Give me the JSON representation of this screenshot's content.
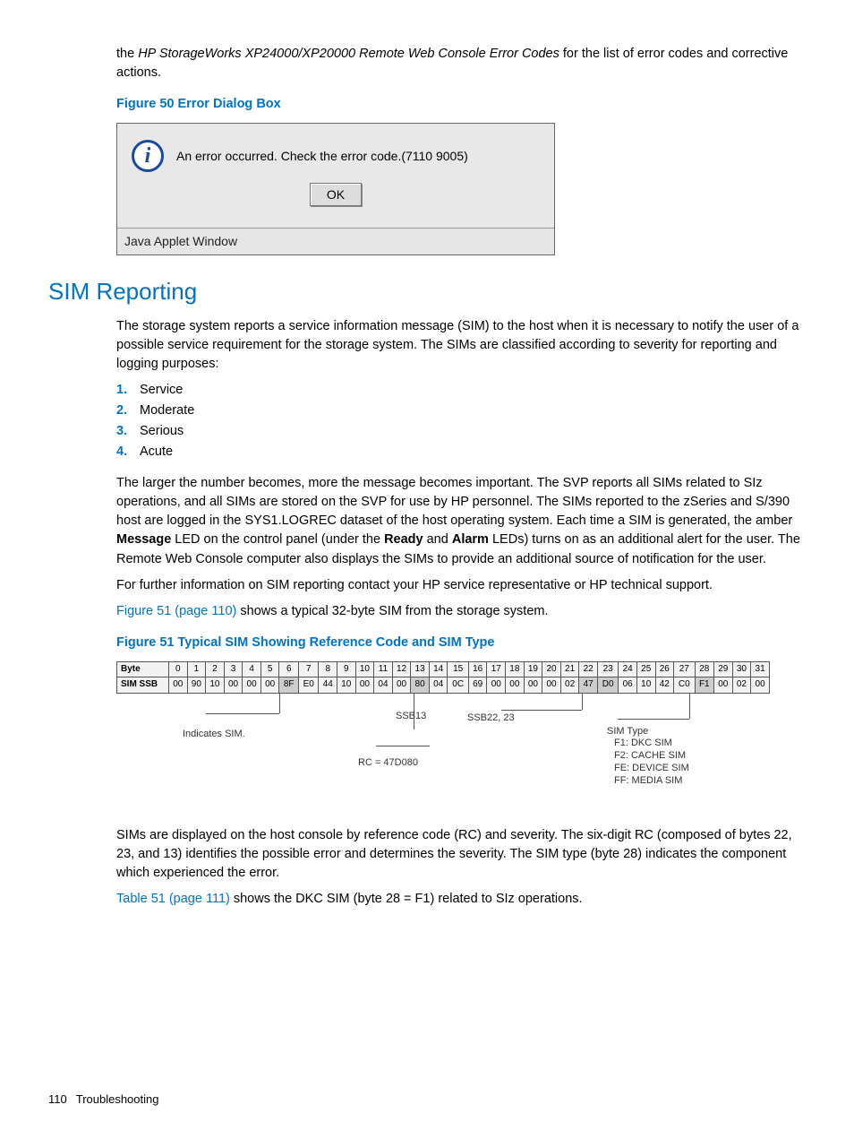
{
  "intro": {
    "prefix": "the ",
    "italic": "HP StorageWorks XP24000/XP20000 Remote Web Console Error Codes",
    "suffix": " for the list of error codes and corrective actions."
  },
  "figure50": {
    "caption": "Figure 50 Error Dialog Box",
    "message": "An error occurred. Check the error code.(7110 9005)",
    "ok": "OK",
    "status": "Java Applet Window"
  },
  "section": {
    "heading": "SIM Reporting",
    "p1": "The storage system reports a service information message (SIM) to the host when it is necessary to notify the user of a possible service requirement for the storage system. The SIMs are classified according to severity for reporting and logging purposes:",
    "list": {
      "n1": "1.",
      "i1": "Service",
      "n2": "2.",
      "i2": "Moderate",
      "n3": "3.",
      "i3": "Serious",
      "n4": "4.",
      "i4": "Acute"
    },
    "p2_a": "The larger the number becomes, more the message becomes important. The SVP reports all SIMs related to SIz operations, and all SIMs are stored on the SVP for use by HP personnel. The SIMs reported to the zSeries and S/390 host are logged in the SYS1.LOGREC dataset of the host operating system. Each time a SIM is generated, the amber ",
    "p2_b_bold": "Message",
    "p2_c": " LED on the control panel (under the ",
    "p2_d_bold": "Ready",
    "p2_e": " and ",
    "p2_f_bold": "Alarm",
    "p2_g": " LEDs) turns on as an additional alert for the user. The Remote Web Console computer also displays the SIMs to provide an additional source of notification for the user.",
    "p3": "For further information on SIM reporting contact your HP service representative or HP technical support.",
    "p4_link": "Figure 51 (page 110)",
    "p4_rest": " shows a typical 32-byte SIM from the storage system."
  },
  "figure51": {
    "caption": "Figure 51 Typical SIM Showing Reference Code and SIM Type",
    "row1_label": "Byte",
    "row2_label": "SIM SSB",
    "bytes_header": [
      "0",
      "1",
      "2",
      "3",
      "4",
      "5",
      "6",
      "7",
      "8",
      "9",
      "10",
      "11",
      "12",
      "13",
      "14",
      "15",
      "16",
      "17",
      "18",
      "19",
      "20",
      "21",
      "22",
      "23",
      "24",
      "25",
      "26",
      "27",
      "28",
      "29",
      "30",
      "31"
    ],
    "bytes_values": [
      "00",
      "90",
      "10",
      "00",
      "00",
      "00",
      "8F",
      "E0",
      "44",
      "10",
      "00",
      "04",
      "00",
      "80",
      "04",
      "0C",
      "69",
      "00",
      "00",
      "00",
      "00",
      "02",
      "47",
      "D0",
      "06",
      "10",
      "42",
      "C0",
      "F1",
      "00",
      "02",
      "00"
    ],
    "anno": {
      "indicates": "Indicates SIM.",
      "ssb13": "SSB13",
      "ssb2223": "SSB22, 23",
      "rc": "RC = 47D080",
      "simtype_title": "SIM Type",
      "simtype_lines": "F1: DKC SIM\nF2: CACHE SIM\nFE: DEVICE SIM\nFF: MEDIA SIM"
    }
  },
  "after": {
    "p1": "SIMs are displayed on the host console by reference code (RC) and severity. The six-digit RC (composed of bytes 22, 23, and 13) identifies the possible error and determines the severity. The SIM type (byte 28) indicates the component which experienced the error.",
    "p2_link": "Table 51 (page 111)",
    "p2_rest": " shows the DKC SIM (byte 28 = F1) related to SIz operations."
  },
  "footer": {
    "page": "110",
    "title": "Troubleshooting"
  }
}
